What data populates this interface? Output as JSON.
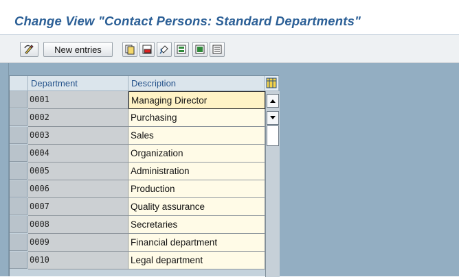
{
  "title": "Change View \"Contact Persons: Standard Departments\"",
  "toolbar": {
    "new_entries_label": "New entries",
    "icons": [
      "toggle-display-change-icon",
      "copy-icon",
      "delete-icon",
      "undo-change-icon",
      "select-all-icon",
      "select-block-icon",
      "deselect-all-icon"
    ]
  },
  "table": {
    "columns": [
      "Department",
      "Description"
    ],
    "rows": [
      {
        "department": "0001",
        "description": "Managing Director"
      },
      {
        "department": "0002",
        "description": "Purchasing"
      },
      {
        "department": "0003",
        "description": "Sales"
      },
      {
        "department": "0004",
        "description": "Organization"
      },
      {
        "department": "0005",
        "description": "Administration"
      },
      {
        "department": "0006",
        "description": "Production"
      },
      {
        "department": "0007",
        "description": "Quality assurance"
      },
      {
        "department": "0008",
        "description": "Secretaries"
      },
      {
        "department": "0009",
        "description": "Financial department"
      },
      {
        "department": "0010",
        "description": "Legal department"
      }
    ]
  },
  "colors": {
    "title": "#2b5f96",
    "workspace": "#93aec2",
    "cell": "#fffbe7",
    "key_cell": "#ccd0d3"
  }
}
